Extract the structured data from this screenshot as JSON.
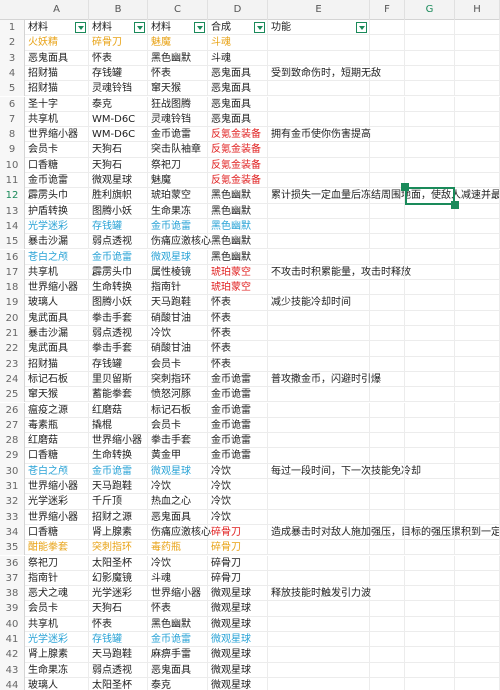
{
  "sheet": {
    "columns": [
      "A",
      "B",
      "C",
      "D",
      "E",
      "F",
      "G",
      "H"
    ],
    "selected_column": "G",
    "selected_row": 12,
    "headers": [
      "材料",
      "材料",
      "材料",
      "合成",
      "功能"
    ],
    "colors": {
      "yellow": "#e8a317",
      "blue": "#29a3d6",
      "red": "#e02020",
      "selection": "#1a8a5a"
    },
    "rows": [
      {
        "n": 2,
        "a": "火妖精",
        "b": "碎骨刀",
        "c": "魅魔",
        "d": "斗魂",
        "e": "",
        "color": "yellow"
      },
      {
        "n": 3,
        "a": "恶鬼面具",
        "b": "怀表",
        "c": "黑色幽默",
        "d": "斗魂",
        "e": ""
      },
      {
        "n": 4,
        "a": "招财猫",
        "b": "存钱罐",
        "c": "怀表",
        "d": "恶鬼面具",
        "e": "受到致命伤时，短期无敌"
      },
      {
        "n": 5,
        "a": "招财猫",
        "b": "灵魂铃铛",
        "c": "窜天猴",
        "d": "恶鬼面具",
        "e": ""
      },
      {
        "n": 6,
        "a": "圣十字",
        "b": "泰克",
        "c": "狂战图腾",
        "d": "恶鬼面具",
        "e": ""
      },
      {
        "n": 7,
        "a": "共享机",
        "b": "WM-D6C",
        "c": "灵魂铃铛",
        "d": "恶鬼面具",
        "e": ""
      },
      {
        "n": 8,
        "a": "世界缩小器",
        "b": "WM-D6C",
        "c": "金币诡雷",
        "d": "反氪金装备",
        "e": "拥有金币使你伤害提高",
        "dcolor": "red"
      },
      {
        "n": 9,
        "a": "会员卡",
        "b": "天狗石",
        "c": "突击队袖章",
        "d": "反氪金装备",
        "e": "",
        "dcolor": "red"
      },
      {
        "n": 10,
        "a": "口香糖",
        "b": "天狗石",
        "c": "祭祀刀",
        "d": "反氪金装备",
        "e": "",
        "dcolor": "red"
      },
      {
        "n": 11,
        "a": "金币诡雷",
        "b": "微观星球",
        "c": "魅魔",
        "d": "反氪金装备",
        "e": "",
        "dcolor": "red"
      },
      {
        "n": 12,
        "a": "霹雳头巾",
        "b": "胜利旗帜",
        "c": "琥珀蒙空",
        "d": "黑色幽默",
        "e": "累计损失一定血量后冻结周围地面，使敌人减速并最终",
        "sel": true
      },
      {
        "n": 13,
        "a": "护盾转换",
        "b": "图腾小妖",
        "c": "生命果冻",
        "d": "黑色幽默",
        "e": ""
      },
      {
        "n": 14,
        "a": "光学迷彩",
        "b": "存钱罐",
        "c": "金币诡雷",
        "d": "黑色幽默",
        "e": "",
        "color": "blue"
      },
      {
        "n": 15,
        "a": "暴击沙漏",
        "b": "弱点透视",
        "c": "伤痛应激核心",
        "d": "黑色幽默",
        "e": ""
      },
      {
        "n": 16,
        "a": "苍白之颅",
        "b": "金币诡雷",
        "c": "微观星球",
        "d": "黑色幽默",
        "e": "",
        "color": "blue",
        "dcolor": "black"
      },
      {
        "n": 17,
        "a": "共享机",
        "b": "霹雳头巾",
        "c": "属性棱镜",
        "d": "琥珀蒙空",
        "e": "不攻击时积累能量，攻击时释放",
        "dcolor": "red"
      },
      {
        "n": 18,
        "a": "世界缩小器",
        "b": "生命转换",
        "c": "指南针",
        "d": "琥珀蒙空",
        "e": "",
        "dcolor": "red"
      },
      {
        "n": 19,
        "a": "玻璃人",
        "b": "图腾小妖",
        "c": "天马跑鞋",
        "d": "怀表",
        "e": "减少技能冷却时间"
      },
      {
        "n": 20,
        "a": "鬼武面具",
        "b": "拳击手套",
        "c": "硝酸甘油",
        "d": "怀表",
        "e": ""
      },
      {
        "n": 21,
        "a": "暴击沙漏",
        "b": "弱点透视",
        "c": "冷饮",
        "d": "怀表",
        "e": ""
      },
      {
        "n": 22,
        "a": "鬼武面具",
        "b": "拳击手套",
        "c": "硝酸甘油",
        "d": "怀表",
        "e": ""
      },
      {
        "n": 23,
        "a": "招财猫",
        "b": "存钱罐",
        "c": "会员卡",
        "d": "怀表",
        "e": ""
      },
      {
        "n": 24,
        "a": "标记石板",
        "b": "里贝留斯",
        "c": "突刺指环",
        "d": "金币诡雷",
        "e": "普攻撒金币，闪避时引爆"
      },
      {
        "n": 25,
        "a": "窜天猴",
        "b": "蓄能拳套",
        "c": "愤怒河豚",
        "d": "金币诡雷",
        "e": ""
      },
      {
        "n": 26,
        "a": "瘟疫之源",
        "b": "红磨菇",
        "c": "标记石板",
        "d": "金币诡雷",
        "e": ""
      },
      {
        "n": 27,
        "a": "毒素瓶",
        "b": "撬棍",
        "c": "会员卡",
        "d": "金币诡雷",
        "e": ""
      },
      {
        "n": 28,
        "a": "红磨菇",
        "b": "世界缩小器",
        "c": "拳击手套",
        "d": "金币诡雷",
        "e": ""
      },
      {
        "n": 29,
        "a": "口香糖",
        "b": "生命转换",
        "c": "黄金甲",
        "d": "金币诡雷",
        "e": ""
      },
      {
        "n": 30,
        "a": "苍白之颅",
        "b": "金币诡雷",
        "c": "微观星球",
        "d": "冷饮",
        "e": "每过一段时间，下一次技能免冷却",
        "color": "blue",
        "dcolor": "black"
      },
      {
        "n": 31,
        "a": "世界缩小器",
        "b": "天马跑鞋",
        "c": "冷饮",
        "d": "冷饮",
        "e": ""
      },
      {
        "n": 32,
        "a": "光学迷彩",
        "b": "千斤顶",
        "c": "热血之心",
        "d": "冷饮",
        "e": ""
      },
      {
        "n": 33,
        "a": "世界缩小器",
        "b": "招财之源",
        "c": "恶鬼面具",
        "d": "冷饮",
        "e": ""
      },
      {
        "n": 34,
        "a": "口香糖",
        "b": "肾上腺素",
        "c": "伤痛应激核心",
        "d": "碎骨刀",
        "e": "造成暴击时对敌人施加强压，目标的强压累积到一定程",
        "dcolor": "red"
      },
      {
        "n": 35,
        "a": "酣能拳套",
        "b": "突刺指环",
        "c": "毒药瓶",
        "d": "碎骨刀",
        "e": "",
        "color": "yellow"
      },
      {
        "n": 36,
        "a": "祭祀刀",
        "b": "太阳圣杯",
        "c": "冷饮",
        "d": "碎骨刀",
        "e": ""
      },
      {
        "n": 37,
        "a": "指南针",
        "b": "幻影魔镜",
        "c": "斗魂",
        "d": "碎骨刀",
        "e": ""
      },
      {
        "n": 38,
        "a": "恶犬之魂",
        "b": "光学迷彩",
        "c": "世界缩小器",
        "d": "微观星球",
        "e": "释放技能时触发引力波"
      },
      {
        "n": 39,
        "a": "会员卡",
        "b": "天狗石",
        "c": "怀表",
        "d": "微观星球",
        "e": ""
      },
      {
        "n": 40,
        "a": "共享机",
        "b": "怀表",
        "c": "黑色幽默",
        "d": "微观星球",
        "e": ""
      },
      {
        "n": 41,
        "a": "光学迷彩",
        "b": "存钱罐",
        "c": "金币诡雷",
        "d": "微观星球",
        "e": "",
        "color": "blue"
      },
      {
        "n": 42,
        "a": "肾上腺素",
        "b": "天马跑鞋",
        "c": "麻痹手雷",
        "d": "微观星球",
        "e": ""
      },
      {
        "n": 43,
        "a": "生命果冻",
        "b": "弱点透视",
        "c": "恶鬼面具",
        "d": "微观星球",
        "e": ""
      },
      {
        "n": 44,
        "a": "玻璃人",
        "b": "太阳圣杯",
        "c": "泰克",
        "d": "微观星球",
        "e": ""
      }
    ]
  }
}
